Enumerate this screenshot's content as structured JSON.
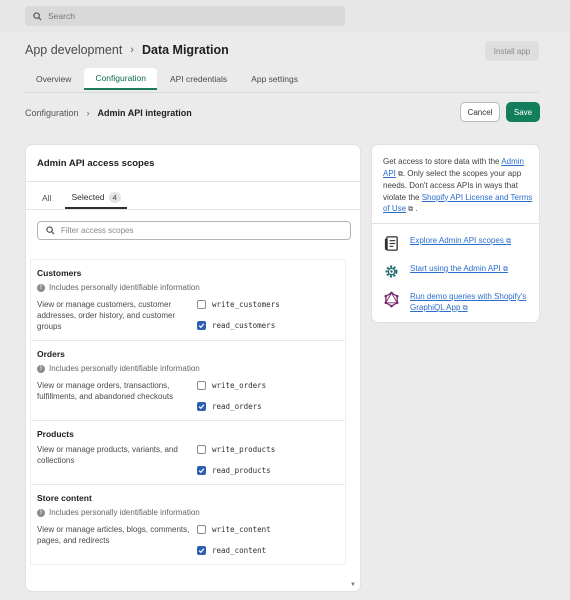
{
  "search": {
    "placeholder": "Search"
  },
  "header": {
    "crumb": "App development",
    "title": "Data Migration",
    "install_label": "Install app"
  },
  "tabs": [
    {
      "label": "Overview"
    },
    {
      "label": "Configuration"
    },
    {
      "label": "API credentials"
    },
    {
      "label": "App settings"
    }
  ],
  "subheader": {
    "crumb": "Configuration",
    "current": "Admin API integration",
    "cancel_label": "Cancel",
    "save_label": "Save"
  },
  "scopes_card": {
    "title": "Admin API access scopes",
    "tab_all": "All",
    "tab_selected": "Selected",
    "selected_count": "4",
    "filter_placeholder": "Filter access scopes",
    "pii_note": "Includes personally identifiable information",
    "sections": [
      {
        "title": "Customers",
        "pii": true,
        "description": "View or manage customers, customer addresses, order history, and customer groups",
        "scopes": [
          {
            "name": "write_customers",
            "checked": false
          },
          {
            "name": "read_customers",
            "checked": true
          }
        ]
      },
      {
        "title": "Orders",
        "pii": true,
        "description": "View or manage orders, transactions, fulfillments, and abandoned checkouts",
        "scopes": [
          {
            "name": "write_orders",
            "checked": false
          },
          {
            "name": "read_orders",
            "checked": true
          }
        ]
      },
      {
        "title": "Products",
        "pii": false,
        "description": "View or manage products, variants, and collections",
        "scopes": [
          {
            "name": "write_products",
            "checked": false
          },
          {
            "name": "read_products",
            "checked": true
          }
        ]
      },
      {
        "title": "Store content",
        "pii": true,
        "description": "View or manage articles, blogs, comments, pages, and redirects",
        "scopes": [
          {
            "name": "write_content",
            "checked": false
          },
          {
            "name": "read_content",
            "checked": true
          }
        ]
      }
    ]
  },
  "side": {
    "intro_1": "Get access to store data with the",
    "link_admin_api": "Admin API",
    "intro_2": ". Only select the scopes your app needs. Don't access APIs in ways that violate the",
    "link_terms": "Shopify API License and Terms of Use",
    "intro_3": ".",
    "resources": [
      {
        "label": "Explore Admin API scopes",
        "icon": "document-icon"
      },
      {
        "label": "Start using the Admin API",
        "icon": "gear-icon"
      },
      {
        "label": "Run demo queries with Shopify's GraphiQL App",
        "icon": "graphql-icon"
      }
    ]
  },
  "colors": {
    "primary": "#137e5c",
    "checkbox": "#2f5fb3",
    "link": "#2c6ecb"
  }
}
